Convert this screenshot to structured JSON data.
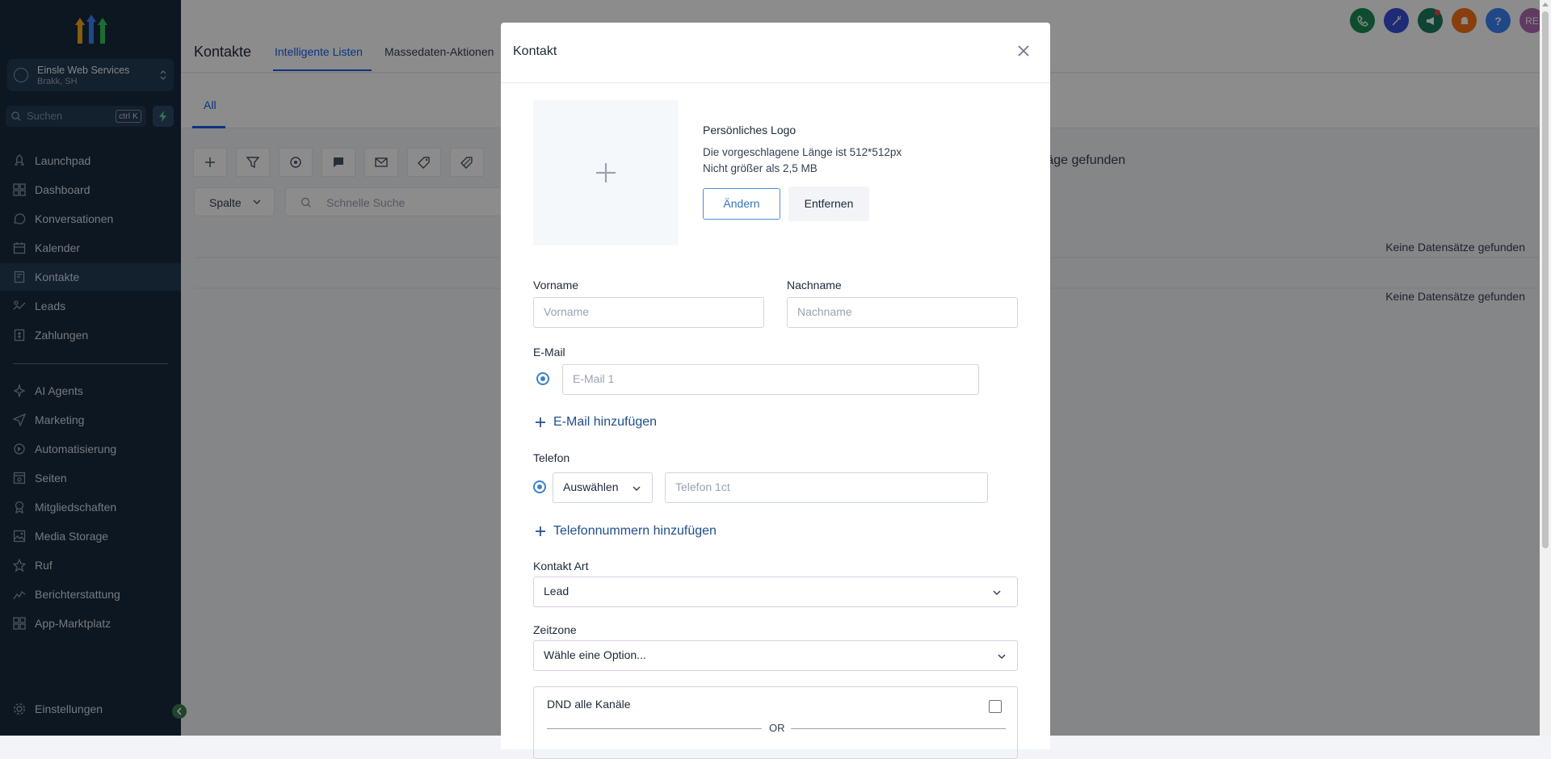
{
  "sidebar": {
    "location": {
      "name": "Einsle Web Services",
      "sub": "Brakk, SH"
    },
    "search": {
      "placeholder": "Suchen",
      "shortcut": "ctrl K"
    },
    "nav": [
      {
        "label": "Launchpad",
        "icon": "rocket-icon"
      },
      {
        "label": "Dashboard",
        "icon": "dashboard-icon"
      },
      {
        "label": "Konversationen",
        "icon": "chat-icon"
      },
      {
        "label": "Kalender",
        "icon": "calendar-icon"
      },
      {
        "label": "Kontakte",
        "icon": "contacts-icon",
        "active": true
      },
      {
        "label": "Leads",
        "icon": "leads-icon"
      },
      {
        "label": "Zahlungen",
        "icon": "payments-icon"
      }
    ],
    "nav2": [
      {
        "label": "AI Agents",
        "icon": "sparkle-icon"
      },
      {
        "label": "Marketing",
        "icon": "send-icon"
      },
      {
        "label": "Automatisierung",
        "icon": "automation-icon"
      },
      {
        "label": "Seiten",
        "icon": "pages-icon"
      },
      {
        "label": "Mitgliedschaften",
        "icon": "membership-icon"
      },
      {
        "label": "Media Storage",
        "icon": "image-icon"
      },
      {
        "label": "Ruf",
        "icon": "star-icon"
      },
      {
        "label": "Berichterstattung",
        "icon": "chart-icon"
      },
      {
        "label": "App-Marktplatz",
        "icon": "apps-icon"
      }
    ],
    "settings": "Einstellungen"
  },
  "header": {
    "title": "Kontakte",
    "tabs": [
      {
        "label": "Intelligente Listen",
        "active": true
      },
      {
        "label": "Massedaten-Aktionen"
      }
    ],
    "avatar_initials": "RE",
    "icon_colors": [
      "#188d54",
      "#3a4fd8",
      "#1d7a5e",
      "#f97316",
      "#3b82f6",
      "#b06ab3"
    ]
  },
  "content": {
    "subtab": "All",
    "column_select": "Spalte",
    "quick_search": "Schnelle Suche",
    "found_text": "räge gefunden",
    "no_records": [
      "Keine Datensätze gefunden",
      "Keine Datensätze gefunden"
    ]
  },
  "modal": {
    "title": "Kontakt",
    "logo": {
      "title": "Persönliches Logo",
      "hint1": "Die vorgeschlagene Länge ist 512*512px",
      "hint2": "Nicht größer als 2,5 MB",
      "change": "Ändern",
      "remove": "Entfernen"
    },
    "first_name": {
      "label": "Vorname",
      "placeholder": "Vorname"
    },
    "last_name": {
      "label": "Nachname",
      "placeholder": "Nachname"
    },
    "email": {
      "label": "E-Mail",
      "placeholder": "E-Mail 1",
      "add": "E-Mail hinzufügen"
    },
    "phone": {
      "label": "Telefon",
      "country": "Auswählen",
      "placeholder": "Telefon 1ct",
      "add": "Telefonnummern hinzufügen"
    },
    "contact_type": {
      "label": "Kontakt Art",
      "value": "Lead"
    },
    "timezone": {
      "label": "Zeitzone",
      "value": "Wähle eine Option..."
    },
    "dnd": {
      "label": "DND alle Kanäle",
      "or": "OR"
    }
  }
}
